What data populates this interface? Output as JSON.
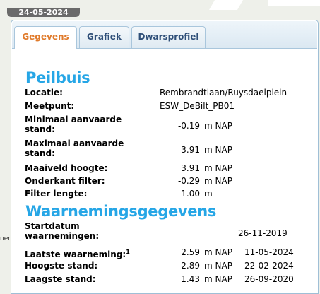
{
  "date_badge": "24-05-2024",
  "tabs": [
    {
      "label": "Gegevens",
      "active": true
    },
    {
      "label": "Grafiek",
      "active": false
    },
    {
      "label": "Dwarsprofiel",
      "active": false
    }
  ],
  "peilbuis": {
    "title": "Peilbuis",
    "locatie_label": "Locatie:",
    "locatie_value": "Rembrandtlaan/Ruysdaelplein",
    "meetpunt_label": "Meetpunt:",
    "meetpunt_value": "ESW_DeBilt_PB01",
    "min_label_1": "Minimaal aanvaarde",
    "min_label_2": "stand:",
    "min_value": "-0.19",
    "min_unit": "m NAP",
    "max_label_1": "Maximaal aanvaarde",
    "max_label_2": "stand:",
    "max_value": "3.91",
    "max_unit": "m NAP",
    "maaiveld_label": "Maaiveld hoogte:",
    "maaiveld_value": "3.91",
    "maaiveld_unit": "m NAP",
    "onderkant_label": "Onderkant filter:",
    "onderkant_value": "-0.29",
    "onderkant_unit": "m NAP",
    "filter_label": "Filter lengte:",
    "filter_value": "1.00",
    "filter_unit": "m"
  },
  "waarnemingen": {
    "title": "Waarnemingsgegevens",
    "start_label_1": "Startdatum",
    "start_label_2": "waarnemingen:",
    "start_date": "26-11-2019",
    "laatste_label": "Laatste waarneming:",
    "laatste_sup": "1",
    "laatste_value": "2.59",
    "laatste_unit": "m NAP",
    "laatste_date": "11-05-2024",
    "hoogste_label": "Hoogste stand:",
    "hoogste_value": "2.89",
    "hoogste_unit": "m NAP",
    "hoogste_date": "22-02-2024",
    "laagste_label": "Laagste stand:",
    "laagste_value": "1.43",
    "laagste_unit": "m NAP",
    "laagste_date": "26-09-2020"
  },
  "side_fragment": "nen"
}
